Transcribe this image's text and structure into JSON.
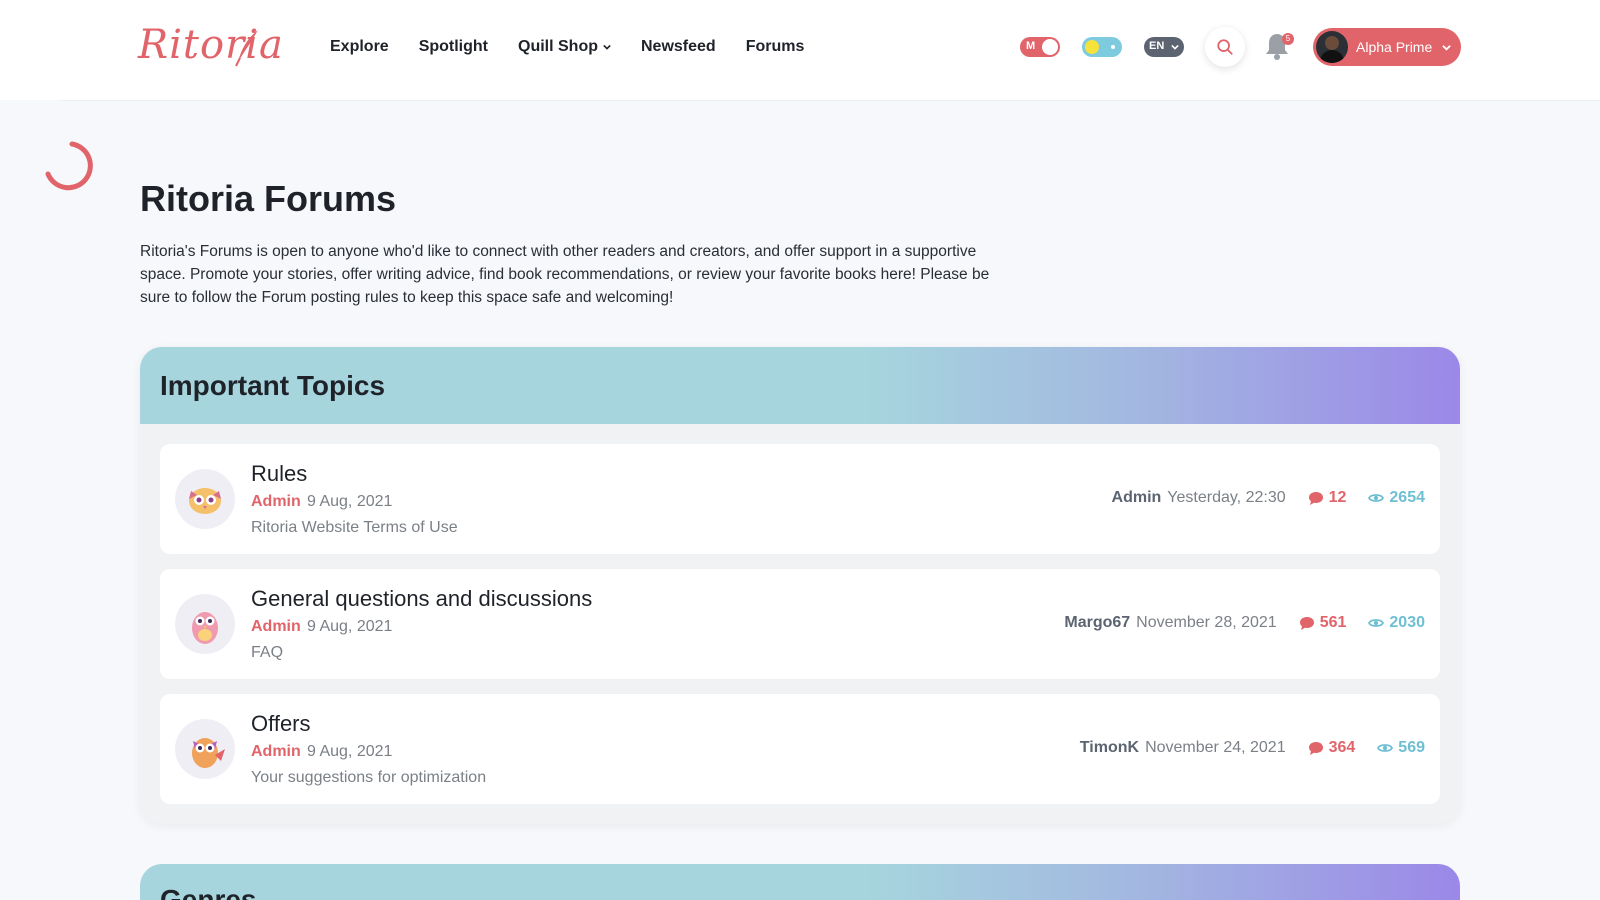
{
  "header": {
    "logo_text": "Ritoria",
    "nav": [
      {
        "label": "Explore"
      },
      {
        "label": "Spotlight"
      },
      {
        "label": "Quill Shop"
      },
      {
        "label": "Newsfeed"
      },
      {
        "label": "Forums"
      }
    ],
    "mature_toggle_label": "M",
    "language_label": "EN",
    "notification_count": "5",
    "user_name": "Alpha Prime"
  },
  "page": {
    "title": "Ritoria Forums",
    "intro": "Ritoria's Forums is open to anyone who'd like to connect with other readers and creators, and offer support in a supportive space. Promote your stories, offer writing advice, find book recommendations, or review your favorite books here! Please be sure to follow the Forum posting rules to keep this space safe and welcoming!"
  },
  "important": {
    "title": "Important Topics",
    "topics": [
      {
        "title": "Rules",
        "author": "Admin",
        "date": "9 Aug, 2021",
        "desc": "Ritoria Website Terms of Use",
        "last_user": "Admin",
        "last_time": "Yesterday, 22:30",
        "comments": "12",
        "views": "2654"
      },
      {
        "title": "General questions and discussions",
        "author": "Admin",
        "date": "9 Aug, 2021",
        "desc": "FAQ",
        "last_user": "Margo67",
        "last_time": "November 28, 2021",
        "comments": "561",
        "views": "2030"
      },
      {
        "title": "Offers",
        "author": "Admin",
        "date": "9 Aug, 2021",
        "desc": "Your suggestions for optimization",
        "last_user": "TimonK",
        "last_time": "November 24, 2021",
        "comments": "364",
        "views": "569"
      }
    ]
  },
  "genres": {
    "title": "Genres"
  },
  "colors": {
    "accent": "#e0646a",
    "views": "#6fbfd2"
  }
}
